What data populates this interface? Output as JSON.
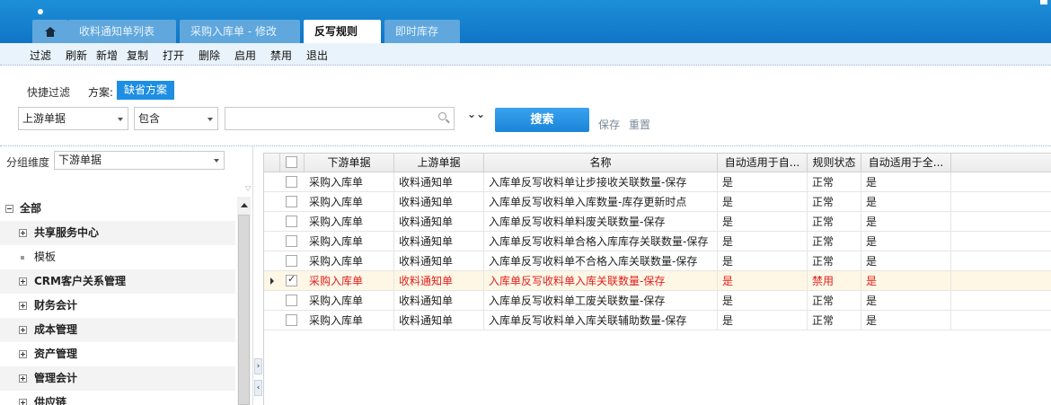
{
  "header": {
    "tabs": [
      {
        "label": "收料通知单列表"
      },
      {
        "label": "采购入库单 - 修改"
      },
      {
        "label": "反写规则",
        "active": true,
        "close": "×"
      },
      {
        "label": "即时库存"
      }
    ]
  },
  "toolbar": {
    "buttons": [
      "过滤",
      "刷新",
      "新增",
      "复制",
      "打开",
      "删除",
      "启用",
      "禁用",
      "退出"
    ]
  },
  "filter": {
    "quick_label": "快捷过滤",
    "scheme_label": "方案:",
    "scheme_value": "缺省方案",
    "field_select": "上游单据",
    "op_select": "包含",
    "search_value": "",
    "expand_symbol": "⌄⌄",
    "search_button": "搜索",
    "save_link": "保存",
    "reset_link": "重置"
  },
  "left_panel": {
    "group_label": "分组维度",
    "group_value": "下游单据",
    "tree": [
      {
        "label": "全部",
        "level": 0,
        "expander": "minus"
      },
      {
        "label": "共享服务中心",
        "level": 1,
        "expander": "plus"
      },
      {
        "label": "模板",
        "level": 1,
        "expander": "leaf"
      },
      {
        "label": "CRM客户关系管理",
        "level": 1,
        "expander": "plus"
      },
      {
        "label": "财务会计",
        "level": 1,
        "expander": "plus"
      },
      {
        "label": "成本管理",
        "level": 1,
        "expander": "plus"
      },
      {
        "label": "资产管理",
        "level": 1,
        "expander": "plus"
      },
      {
        "label": "管理会计",
        "level": 1,
        "expander": "plus"
      },
      {
        "label": "供应链",
        "level": 1,
        "expander": "plus"
      }
    ]
  },
  "grid": {
    "columns": [
      "下游单据",
      "上游单据",
      "名称",
      "自动适用于自...",
      "规则状态",
      "自动适用于全..."
    ],
    "rows": [
      {
        "down": "采购入库单",
        "up": "收料通知单",
        "name": "入库单反写收料单让步接收关联数量-保存",
        "auto_self": "是",
        "status": "正常",
        "auto_all": "是",
        "checked": false,
        "selected": false
      },
      {
        "down": "采购入库单",
        "up": "收料通知单",
        "name": "入库单反写收料单入库数量-库存更新时点",
        "auto_self": "是",
        "status": "正常",
        "auto_all": "是",
        "checked": false,
        "selected": false
      },
      {
        "down": "采购入库单",
        "up": "收料通知单",
        "name": "入库单反写收料单料废关联数量-保存",
        "auto_self": "是",
        "status": "正常",
        "auto_all": "是",
        "checked": false,
        "selected": false
      },
      {
        "down": "采购入库单",
        "up": "收料通知单",
        "name": "入库单反写收料单合格入库库存关联数量-保存",
        "auto_self": "是",
        "status": "正常",
        "auto_all": "是",
        "checked": false,
        "selected": false
      },
      {
        "down": "采购入库单",
        "up": "收料通知单",
        "name": "入库单反写收料单不合格入库关联数量-保存",
        "auto_self": "是",
        "status": "正常",
        "auto_all": "是",
        "checked": false,
        "selected": false
      },
      {
        "down": "采购入库单",
        "up": "收料通知单",
        "name": "入库单反写收料单入库关联数量-保存",
        "auto_self": "是",
        "status": "禁用",
        "auto_all": "是",
        "checked": true,
        "selected": true
      },
      {
        "down": "采购入库单",
        "up": "收料通知单",
        "name": "入库单反写收料单工废关联数量-保存",
        "auto_self": "是",
        "status": "正常",
        "auto_all": "是",
        "checked": false,
        "selected": false
      },
      {
        "down": "采购入库单",
        "up": "收料通知单",
        "name": "入库单反写收料单入库关联辅助数量-保存",
        "auto_self": "是",
        "status": "正常",
        "auto_all": "是",
        "checked": false,
        "selected": false
      }
    ]
  },
  "colors": {
    "accent": "#1e8ee4",
    "selected_text": "#e02020",
    "selected_row_bg": "#fff7e6"
  }
}
